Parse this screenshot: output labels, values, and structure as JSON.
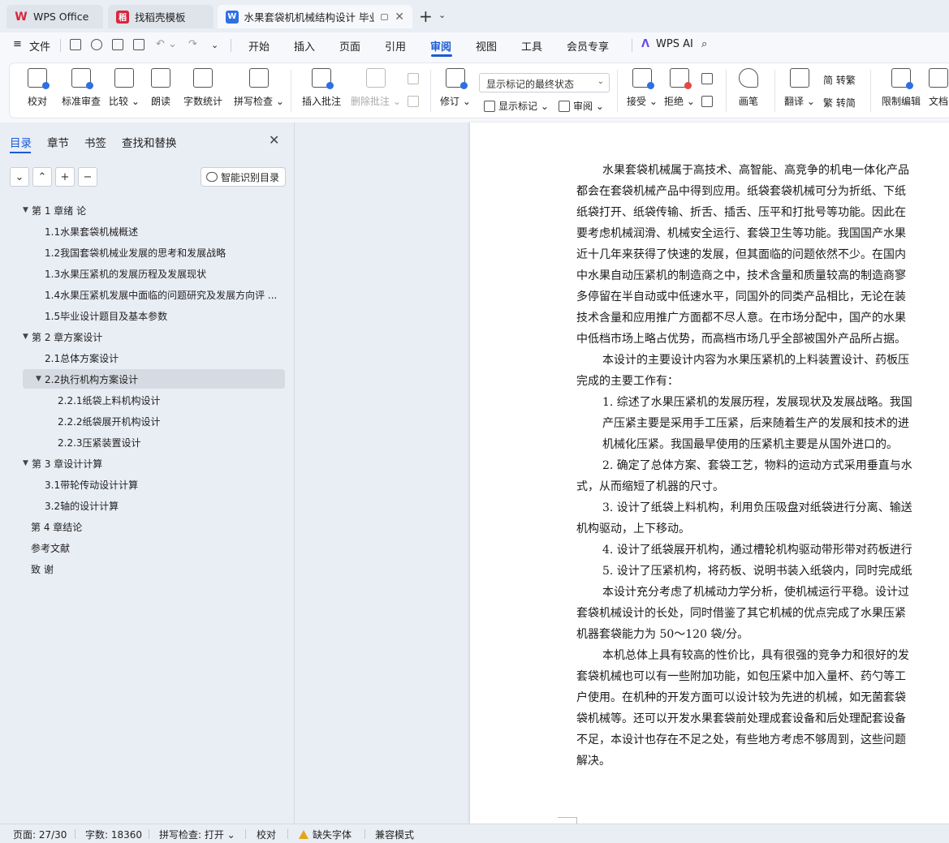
{
  "tabs": [
    {
      "label": "WPS Office"
    },
    {
      "label": "找稻壳模板"
    },
    {
      "label": "水果套袋机机械结构设计 毕业"
    }
  ],
  "menu": {
    "file": "文件",
    "items": [
      "开始",
      "插入",
      "页面",
      "引用",
      "审阅",
      "视图",
      "工具",
      "会员专享"
    ],
    "active": "审阅",
    "wps_ai": "WPS AI"
  },
  "ribbon": {
    "proofread": "校对",
    "standard_review": "标准审查",
    "compare": "比较",
    "read_aloud": "朗读",
    "word_count": "字数统计",
    "spell_check": "拼写检查",
    "insert_comment": "插入批注",
    "delete_comment": "删除批注",
    "track_changes": "修订",
    "markup_select": "显示标记的最终状态",
    "show_markup": "显示标记",
    "review": "审阅",
    "accept": "接受",
    "reject": "拒绝",
    "ink": "画笔",
    "translate": "翻译",
    "to_traditional": "简 转繁",
    "to_simplified": "繁 转简",
    "restrict_edit": "限制编辑",
    "doc_partial": "文档"
  },
  "nav": {
    "tabs": [
      "目录",
      "章节",
      "书签",
      "查找和替换"
    ],
    "smart_button": "智能识别目录",
    "toc": [
      {
        "label": "第 1 章绪  论",
        "level": 1,
        "expanded": true
      },
      {
        "label": "1.1水果套袋机械概述",
        "level": 2
      },
      {
        "label": "1.2我国套袋机械业发展的思考和发展战略",
        "level": 2
      },
      {
        "label": "1.3水果压紧机的发展历程及发展现状",
        "level": 2
      },
      {
        "label": "1.4水果压紧机发展中面临的问题研究及发展方向评 ...",
        "level": 2
      },
      {
        "label": "1.5毕业设计题目及基本参数",
        "level": 2
      },
      {
        "label": "第 2 章方案设计",
        "level": 1,
        "expanded": true
      },
      {
        "label": "2.1总体方案设计",
        "level": 2
      },
      {
        "label": "2.2执行机构方案设计",
        "level": 2,
        "expanded": true,
        "selected": true
      },
      {
        "label": "2.2.1纸袋上料机构设计",
        "level": 3
      },
      {
        "label": "2.2.2纸袋展开机构设计",
        "level": 3
      },
      {
        "label": "2.2.3压紧装置设计",
        "level": 3
      },
      {
        "label": "第 3 章设计计算",
        "level": 1,
        "expanded": true
      },
      {
        "label": "3.1带轮传动设计计算",
        "level": 2
      },
      {
        "label": "3.2轴的设计计算",
        "level": 2
      },
      {
        "label": "第 4 章结论",
        "level": 1
      },
      {
        "label": "参考文献",
        "level": 1
      },
      {
        "label": "致  谢",
        "level": 1
      }
    ]
  },
  "document": {
    "lines": [
      {
        "text": "水果套袋机械属于高技术、高智能、高竞争的机电一体化产品",
        "indent": true
      },
      {
        "text": "都会在套袋机械产品中得到应用。纸袋套袋机械可分为折纸、下纸",
        "indent": false
      },
      {
        "text": "纸袋打开、纸袋传输、折舌、插舌、压平和打批号等功能。因此在",
        "indent": false
      },
      {
        "text": "要考虑机械润滑、机械安全运行、套袋卫生等功能。我国国产水果",
        "indent": false
      },
      {
        "text": "近十几年来获得了快速的发展，但其面临的问题依然不少。在国内",
        "indent": false
      },
      {
        "text": "中水果自动压紧机的制造商之中，技术含量和质量较高的制造商寥",
        "indent": false
      },
      {
        "text": "多停留在半自动或中低速水平，同国外的同类产品相比，无论在装",
        "indent": false
      },
      {
        "text": "技术含量和应用推广方面都不尽人意。在市场分配中，国产的水果",
        "indent": false
      },
      {
        "text": "中低档市场上略占优势，而高档市场几乎全部被国外产品所占据。",
        "indent": false
      },
      {
        "text": "本设计的主要设计内容为水果压紧机的上料装置设计、药板压",
        "indent": true
      },
      {
        "text": "完成的主要工作有：",
        "indent": false
      },
      {
        "text": "1.  综述了水果压紧机的发展历程，发展现状及发展战略。我国",
        "indent": true
      },
      {
        "text": "产压紧主要是采用手工压紧，后来随着生产的发展和技术的进",
        "indent": "deep"
      },
      {
        "text": "机械化压紧。我国最早使用的压紧机主要是从国外进口的。",
        "indent": "deep"
      },
      {
        "text": "2.  确定了总体方案、套袋工艺，物料的运动方式采用垂直与水",
        "indent": true
      },
      {
        "text": "式，从而缩短了机器的尺寸。",
        "indent": false
      },
      {
        "text": "3.  设计了纸袋上料机构，利用负压吸盘对纸袋进行分离、输送",
        "indent": true
      },
      {
        "text": "机构驱动，上下移动。",
        "indent": false
      },
      {
        "text": "4.  设计了纸袋展开机构，通过槽轮机构驱动带形带对药板进行",
        "indent": true
      },
      {
        "text": "5.  设计了压紧机构，将药板、说明书装入纸袋内，同时完成纸",
        "indent": true
      },
      {
        "text": "本设计充分考虑了机械动力学分析，使机械运行平稳。设计过",
        "indent": true
      },
      {
        "text": "套袋机械设计的长处，同时借鉴了其它机械的优点完成了水果压紧",
        "indent": false
      },
      {
        "text": "机器套袋能力为 50～120 袋/分。",
        "indent": false
      },
      {
        "text": "本机总体上具有较高的性价比，具有很强的竞争力和很好的发",
        "indent": true
      },
      {
        "text": "套袋机械也可以有一些附加功能，如包压紧中加入量杯、药勺等工",
        "indent": false
      },
      {
        "text": "户使用。在机种的开发方面可以设计较为先进的机械，如无菌套袋",
        "indent": false
      },
      {
        "text": "袋机械等。还可以开发水果套袋前处理成套设备和后处理配套设备",
        "indent": false
      },
      {
        "text": "不足，本设计也存在不足之处，有些地方考虑不够周到，这些问题",
        "indent": false
      },
      {
        "text": "解决。",
        "indent": false
      }
    ]
  },
  "status": {
    "page": "页面: 27/30",
    "words": "字数: 18360",
    "spell": "拼写检查: 打开",
    "proof": "校对",
    "missing_font": "缺失字体",
    "compat": "兼容模式"
  },
  "colors": {
    "accent": "#1b5bd6",
    "chrome_bg": "#e9edf4",
    "ribbon_bg": "#f6f8fb",
    "warning": "#e8a317"
  }
}
